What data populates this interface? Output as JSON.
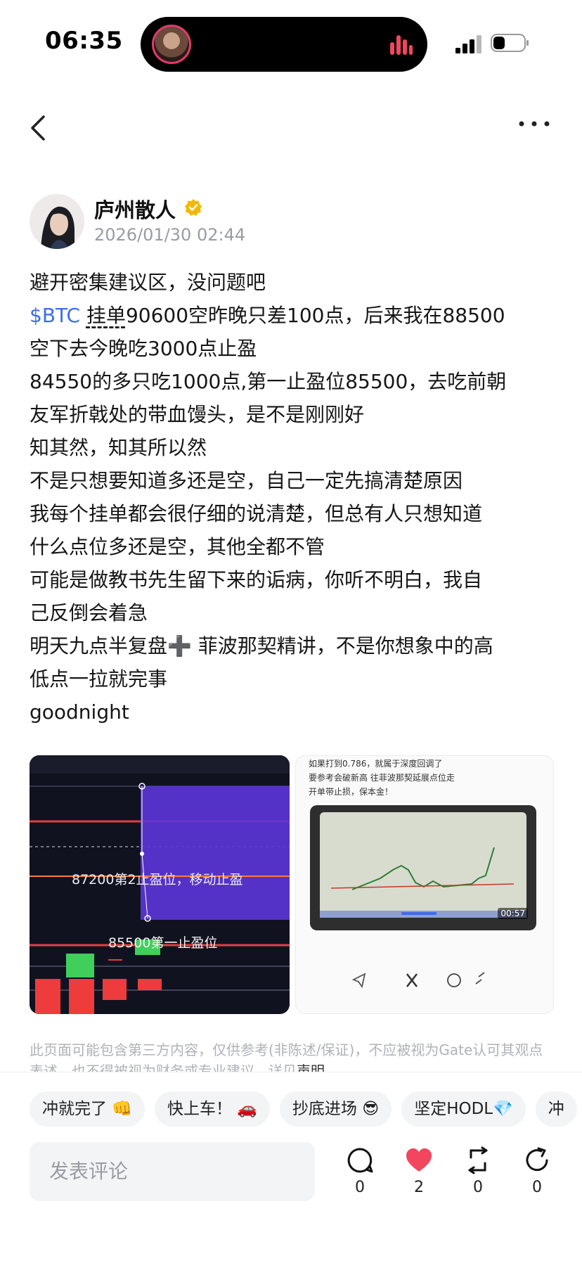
{
  "status_bar": {
    "time": "06:35"
  },
  "author": {
    "name": "庐州散人",
    "time": "2026/01/30 02:44"
  },
  "post": {
    "lines": [
      "避开密集建议区，没问题吧",
      "空下去今晚吃3000点止盈",
      "84550的多只吃1000点,第一止盈位85500，去吃前朝",
      "友军折戟处的带血馒头，是不是刚刚好",
      "知其然，知其所以然",
      "不是只想要知道多还是空，自己一定先搞清楚原因",
      "我每个挂单都会很仔细的说清楚，但总有人只想知道",
      "什么点位多还是空，其他全都不管",
      "可能是做教书先生留下来的诟病，你听不明白，我自",
      "己反倒会着急",
      "明天九点半复盘➕ 菲波那契精讲，不是你想象中的高",
      "低点一拉就完事",
      "goodnight"
    ],
    "ticker": "$BTC",
    "ticker_word": "挂单",
    "ticker_rest": "90600空昨晚只差100点，后来我在88500"
  },
  "image1": {
    "label_top": "87200第2止盈位，移动止盈",
    "label_bottom": "85500第一止盈位"
  },
  "image2": {
    "text_lines": [
      "如果打到0.786，就属于深度回调了",
      "要参考会破新高 往菲波那契延展点位走",
      "开单带止损，保本金！"
    ],
    "video_time": "00:57"
  },
  "disclaimer": {
    "text": "此页面可能包含第三方内容，仅供参考(非陈述/保证)，不应被视为Gate认可其观点表述，也不得被视为财务或专业建议。详见",
    "link": "声明"
  },
  "chips": [
    "冲就完了 👊",
    "快上车！ 🚗",
    "抄底进场 😎",
    "坚定HODL💎",
    "冲"
  ],
  "comment": {
    "placeholder": "发表评论"
  },
  "actions": {
    "comments": "0",
    "likes": "2",
    "reposts": "0",
    "shares": "0"
  },
  "colors": {
    "accent": "#3b6ee8",
    "like": "#f2465e",
    "island_ring": "#e23a6d",
    "verified": "#f0b90b"
  }
}
